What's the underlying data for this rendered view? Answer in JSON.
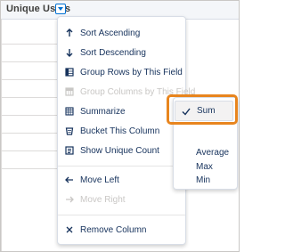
{
  "table": {
    "column_title": "Unique Users"
  },
  "menu": {
    "items": [
      {
        "label": "Sort Ascending",
        "icon": "arrow-up-icon",
        "disabled": false
      },
      {
        "label": "Sort Descending",
        "icon": "arrow-down-icon",
        "disabled": false
      },
      {
        "label": "Group Rows by This Field",
        "icon": "group-rows-icon",
        "disabled": false
      },
      {
        "label": "Group Columns by This Field",
        "icon": "group-columns-icon",
        "disabled": true
      },
      {
        "label": "Summarize",
        "icon": "summarize-icon",
        "disabled": false,
        "has_submenu": true
      },
      {
        "label": "Bucket This Column",
        "icon": "bucket-icon",
        "disabled": false
      },
      {
        "label": "Show Unique Count",
        "icon": "unique-count-icon",
        "disabled": false
      },
      {
        "label": "Move Left",
        "icon": "arrow-left-icon",
        "disabled": false
      },
      {
        "label": "Move Right",
        "icon": "arrow-right-icon",
        "disabled": true
      },
      {
        "label": "Remove Column",
        "icon": "close-icon",
        "disabled": false
      }
    ]
  },
  "submenu": {
    "selected": "Sum",
    "items": [
      "Sum",
      "Average",
      "Max",
      "Min"
    ]
  },
  "colors": {
    "highlight": "#e8851e",
    "accent": "#0070d2",
    "text": "#16325c",
    "disabled": "#c9c7c5"
  }
}
